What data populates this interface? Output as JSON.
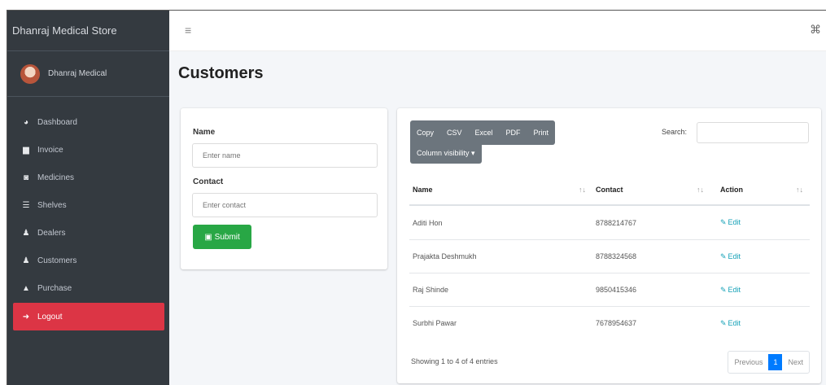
{
  "sidebar": {
    "brand": "Dhanraj Medical Store",
    "user": "Dhanraj Medical",
    "items": [
      {
        "label": "Dashboard",
        "icon": "dashboard-icon"
      },
      {
        "label": "Invoice",
        "icon": "invoice-icon"
      },
      {
        "label": "Medicines",
        "icon": "medicines-icon"
      },
      {
        "label": "Shelves",
        "icon": "shelves-icon"
      },
      {
        "label": "Dealers",
        "icon": "dealers-icon"
      },
      {
        "label": "Customers",
        "icon": "customers-icon"
      },
      {
        "label": "Purchase",
        "icon": "purchase-icon"
      },
      {
        "label": "Logout",
        "icon": "logout-icon"
      }
    ]
  },
  "page": {
    "title": "Customers"
  },
  "form": {
    "name_label": "Name",
    "name_placeholder": "Enter name",
    "contact_label": "Contact",
    "contact_placeholder": "Enter contact",
    "submit_label": "Submit"
  },
  "table": {
    "buttons": [
      "Copy",
      "CSV",
      "Excel",
      "PDF",
      "Print"
    ],
    "column_visibility": "Column visibility ▾",
    "search_label": "Search:",
    "columns": [
      "Name",
      "Contact",
      "Action"
    ],
    "rows": [
      {
        "name": "Aditi Hon",
        "contact": "8788214767",
        "action": "Edit"
      },
      {
        "name": "Prajakta Deshmukh",
        "contact": "8788324568",
        "action": "Edit"
      },
      {
        "name": "Raj Shinde",
        "contact": "9850415346",
        "action": "Edit"
      },
      {
        "name": "Surbhi Pawar",
        "contact": "7678954637",
        "action": "Edit"
      }
    ],
    "info": "Showing 1 to 4 of 4 entries",
    "pagination": {
      "previous": "Previous",
      "current": "1",
      "next": "Next"
    }
  },
  "colors": {
    "sidebar": "#343a40",
    "logout": "#dc3545",
    "submit": "#28a745",
    "primary": "#007bff",
    "buttons": "#6c757d"
  }
}
